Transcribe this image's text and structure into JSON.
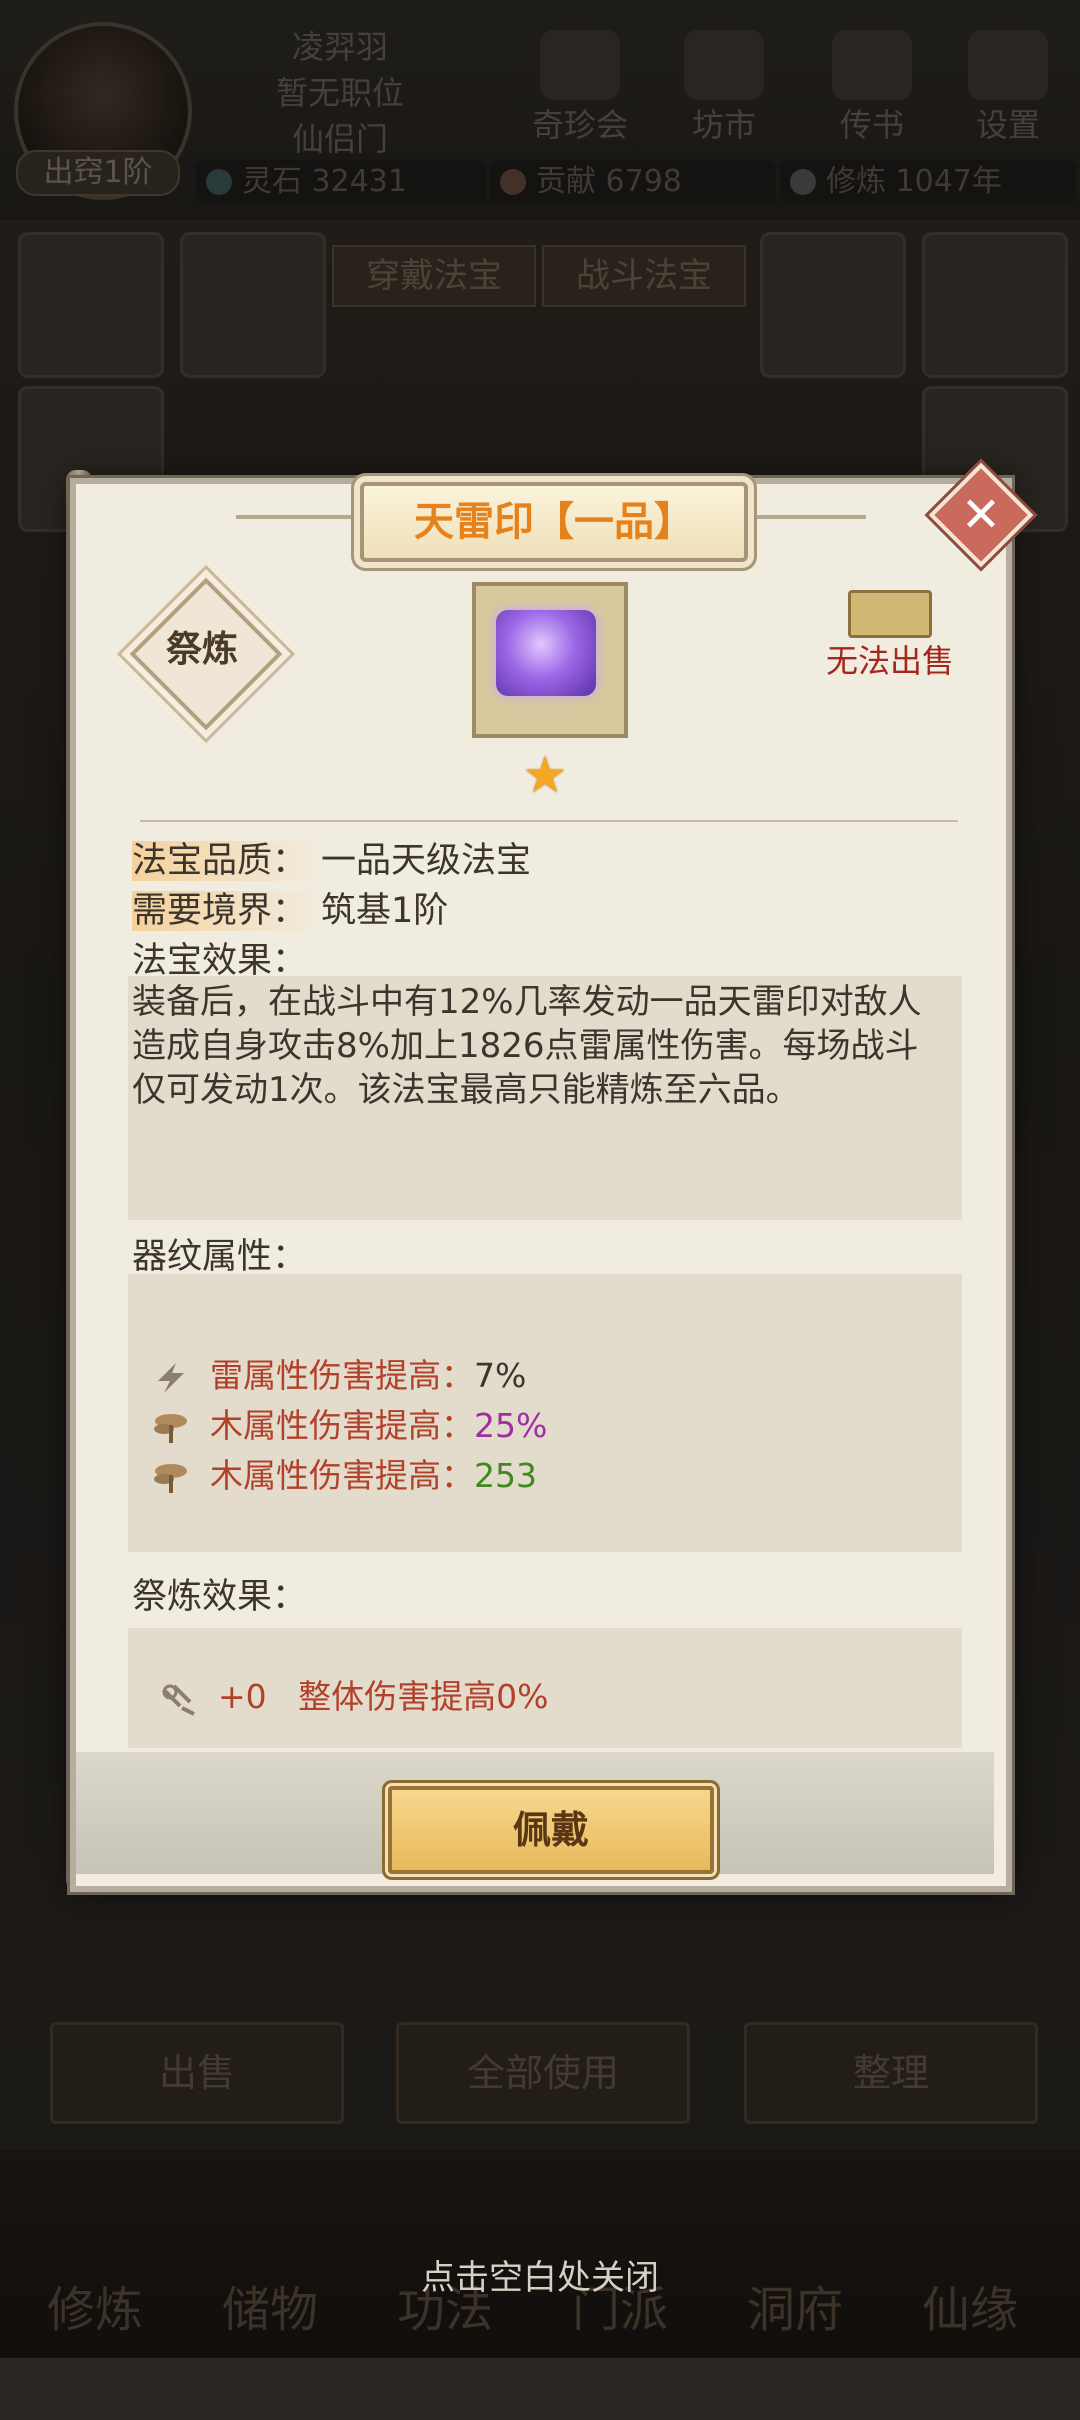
{
  "player": {
    "name": "凌羿羽",
    "position": "暂无职位",
    "sect": "仙侣门",
    "realm": "出窍1阶"
  },
  "top_buttons": [
    "奇珍会",
    "坊市",
    "传书",
    "设置"
  ],
  "resources": {
    "spirit_stone": "灵石 32431",
    "contribution": "贡献 6798",
    "cultivation": "修炼 1047年"
  },
  "bg_tabs": [
    "穿戴法宝",
    "战斗法宝"
  ],
  "bag_buttons": [
    "出售",
    "全部使用",
    "整理"
  ],
  "bottom_nav": [
    "修炼",
    "储物",
    "功法",
    "门派",
    "洞府",
    "仙缘"
  ],
  "close_hint": "点击空白处关闭",
  "dialog": {
    "title": "天雷印【一品】",
    "refine_label": "祭炼",
    "no_sale": "无法出售",
    "quality_label": "法宝品质：",
    "quality_value": "一品天级法宝",
    "realm_label": "需要境界：",
    "realm_value": "筑基1阶",
    "effect_label": "法宝效果：",
    "effect_text": "装备后，在战斗中有12%几率发动一品天雷印对敌人造成自身攻击8%加上1826点雷属性伤害。每场战斗仅可发动1次。该法宝最高只能精炼至六品。",
    "pattern_label": "器纹属性：",
    "attributes": [
      {
        "name": "雷属性伤害提高：",
        "value": "7%",
        "icon": "lightning-icon",
        "color": "#3c352d"
      },
      {
        "name": "木属性伤害提高：",
        "value": "25%",
        "icon": "tree-icon",
        "color": "#a02ea0"
      },
      {
        "name": "木属性伤害提高：",
        "value": "253",
        "icon": "tree-icon",
        "color": "#3f8a1c"
      }
    ],
    "refine_effect_label": "祭炼效果：",
    "refine_level": "+0",
    "refine_effect": "整体伤害提高0%",
    "wear_button": "佩戴"
  }
}
